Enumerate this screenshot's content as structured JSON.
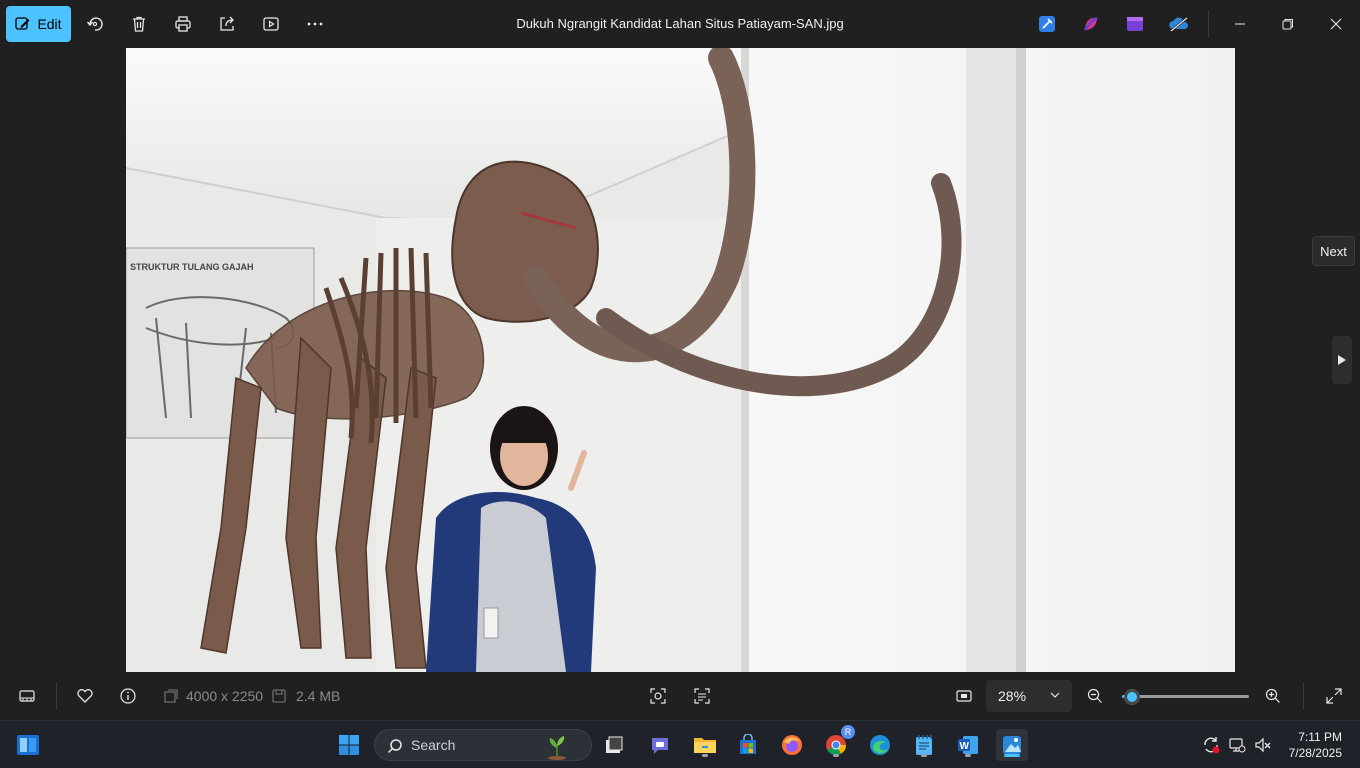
{
  "toolbar": {
    "edit_label": "Edit",
    "title": "Dukuh Ngrangit Kandidat Lahan Situs Patiayam-SAN.jpg"
  },
  "viewer": {
    "next_tooltip": "Next"
  },
  "bottombar": {
    "dimensions": "4000 x 2250",
    "file_size": "2.4 MB",
    "zoom_value": "28%",
    "zoom_level": 0.05
  },
  "taskbar": {
    "search_placeholder": "Search",
    "time": "7:11 PM",
    "date": "7/28/2025",
    "chrome_profile_badge": "R"
  },
  "photo": {
    "poster_text": "STRUKTUR TULANG GAJAH"
  },
  "colors": {
    "accent": "#4cc2ff",
    "background": "#202020",
    "taskbar": "#1f2329"
  }
}
